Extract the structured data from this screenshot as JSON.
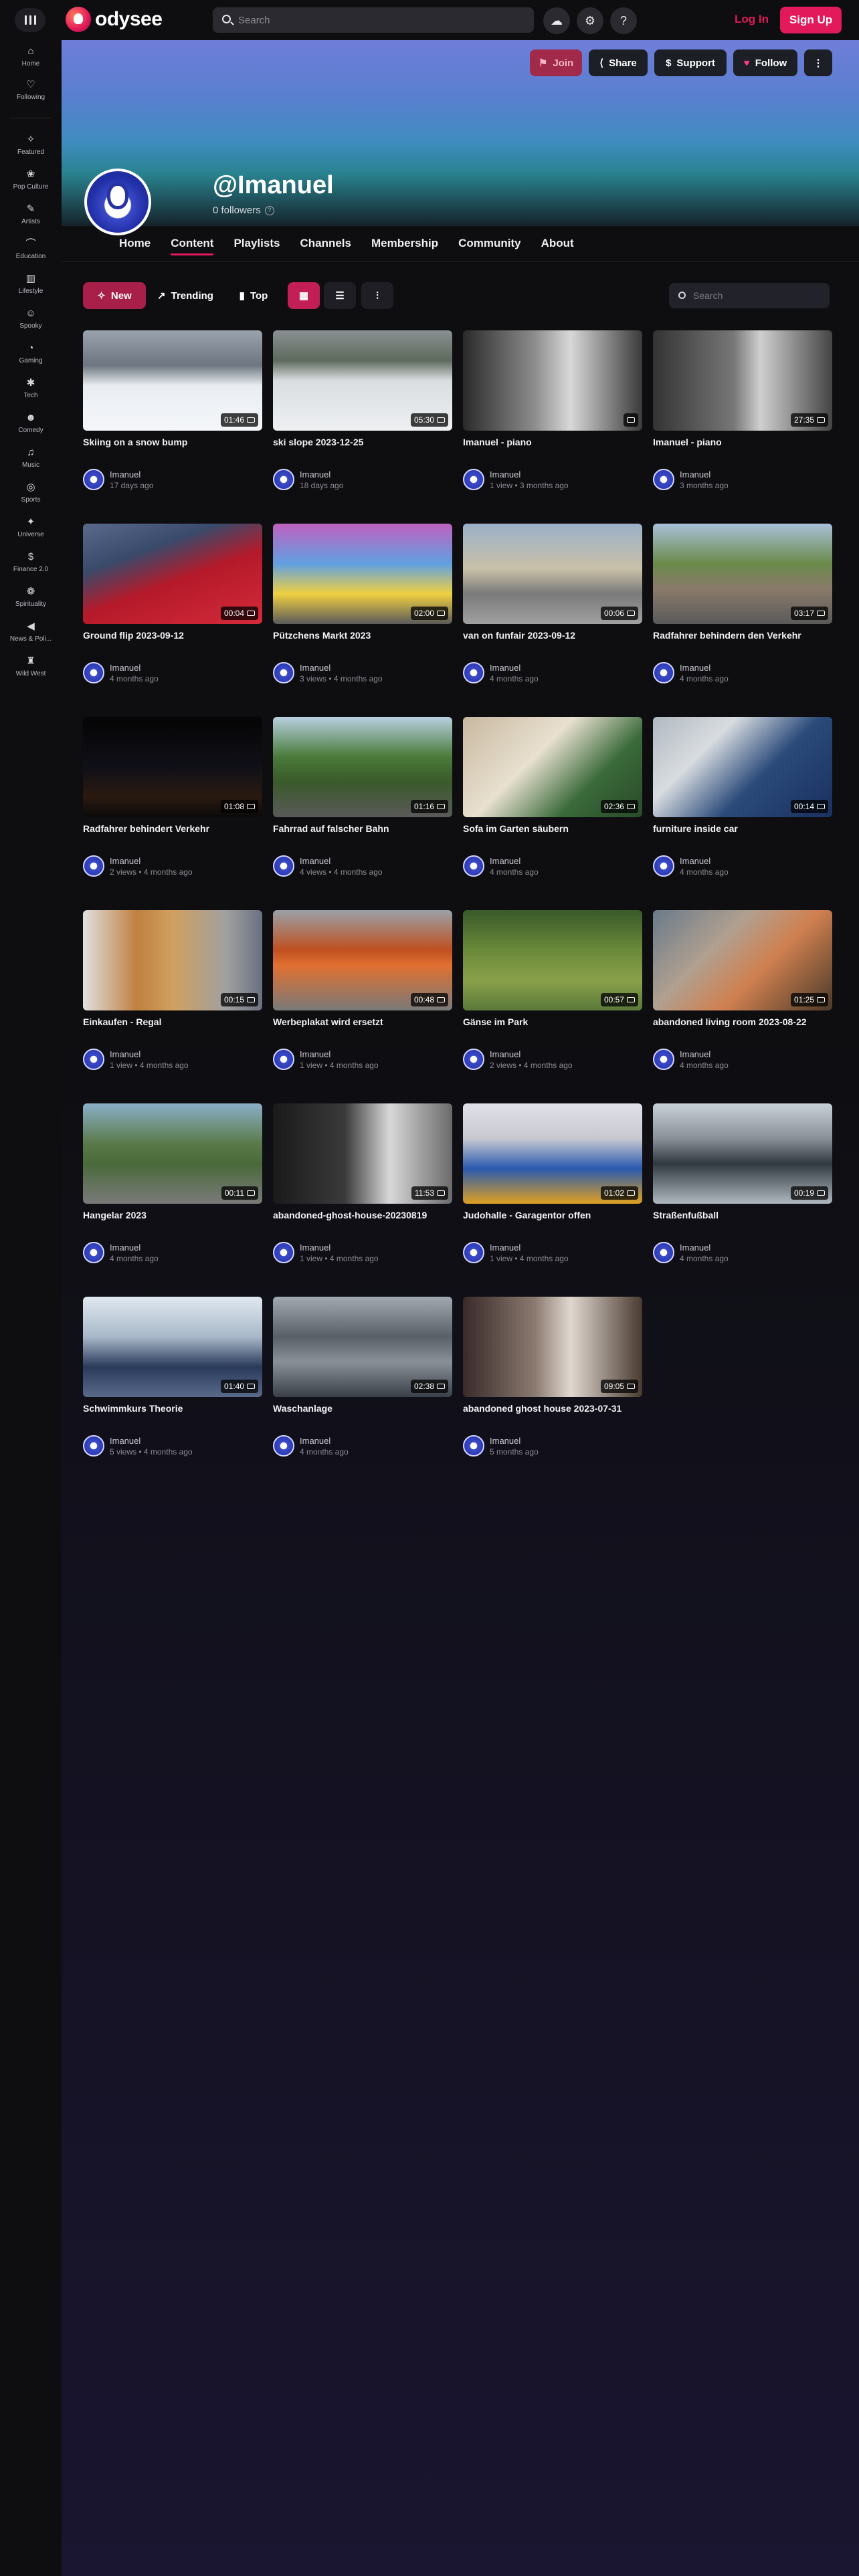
{
  "header": {
    "logo_text": "odysee",
    "search_placeholder": "Search",
    "login_label": "Log In",
    "signup_label": "Sign Up"
  },
  "sidebar": {
    "items": [
      {
        "label": "Home",
        "icon": "home-icon",
        "glyph": "⌂"
      },
      {
        "label": "Following",
        "icon": "heart-icon",
        "glyph": "♡"
      },
      {
        "label": "Featured",
        "icon": "sparkle-icon",
        "glyph": "✧"
      },
      {
        "label": "Pop Culture",
        "icon": "popcorn-icon",
        "glyph": "❀"
      },
      {
        "label": "Artists",
        "icon": "brush-icon",
        "glyph": "✎"
      },
      {
        "label": "Education",
        "icon": "graduation-icon",
        "glyph": "⌒"
      },
      {
        "label": "Lifestyle",
        "icon": "building-icon",
        "glyph": "▥"
      },
      {
        "label": "Spooky",
        "icon": "ghost-icon",
        "glyph": "☺"
      },
      {
        "label": "Gaming",
        "icon": "gamepad-icon",
        "glyph": "◔"
      },
      {
        "label": "Tech",
        "icon": "chip-icon",
        "glyph": "✱"
      },
      {
        "label": "Comedy",
        "icon": "mask-icon",
        "glyph": "☻"
      },
      {
        "label": "Music",
        "icon": "music-icon",
        "glyph": "♫"
      },
      {
        "label": "Sports",
        "icon": "ball-icon",
        "glyph": "◎"
      },
      {
        "label": "Universe",
        "icon": "planet-icon",
        "glyph": "✦"
      },
      {
        "label": "Finance 2.0",
        "icon": "dollar-icon",
        "glyph": "$"
      },
      {
        "label": "Spirituality",
        "icon": "lotus-icon",
        "glyph": "❁"
      },
      {
        "label": "News & Poli...",
        "icon": "megaphone-icon",
        "glyph": "◀"
      },
      {
        "label": "Wild West",
        "icon": "cowboy-icon",
        "glyph": "♜"
      }
    ]
  },
  "channel": {
    "name": "@Imanuel",
    "followers": "0 followers",
    "buttons": {
      "join": "Join",
      "share": "Share",
      "support": "Support",
      "follow": "Follow"
    },
    "tabs": [
      "Home",
      "Content",
      "Playlists",
      "Channels",
      "Membership",
      "Community",
      "About"
    ],
    "active_tab": "Content"
  },
  "filters": {
    "new": "New",
    "trending": "Trending",
    "top": "Top",
    "search_placeholder": "Search"
  },
  "colors": {
    "accent": "#e2195a",
    "background": "#0e0e11"
  },
  "videos": [
    {
      "title": "Skiing on a snow bump",
      "owner": "Imanuel",
      "meta": "17 days ago",
      "duration": "01:46"
    },
    {
      "title": "ski slope 2023-12-25",
      "owner": "Imanuel",
      "meta": "18 days ago",
      "duration": "05:30"
    },
    {
      "title": "Imanuel - piano",
      "owner": "Imanuel",
      "meta": "1 view • 3 months ago",
      "duration": ""
    },
    {
      "title": "Imanuel - piano",
      "owner": "Imanuel",
      "meta": "3 months ago",
      "duration": "27:35"
    },
    {
      "title": "Ground flip 2023-09-12",
      "owner": "Imanuel",
      "meta": "4 months ago",
      "duration": "00:04"
    },
    {
      "title": "Pützchens Markt 2023",
      "owner": "Imanuel",
      "meta": "3 views • 4 months ago",
      "duration": "02:00"
    },
    {
      "title": "van on funfair 2023-09-12",
      "owner": "Imanuel",
      "meta": "4 months ago",
      "duration": "00:06"
    },
    {
      "title": "Radfahrer behindern den Verkehr",
      "owner": "Imanuel",
      "meta": "4 months ago",
      "duration": "03:17"
    },
    {
      "title": "Radfahrer behindert Verkehr",
      "owner": "Imanuel",
      "meta": "2 views • 4 months ago",
      "duration": "01:08"
    },
    {
      "title": "Fahrrad auf falscher Bahn",
      "owner": "Imanuel",
      "meta": "4 views • 4 months ago",
      "duration": "01:16"
    },
    {
      "title": "Sofa im Garten säubern",
      "owner": "Imanuel",
      "meta": "4 months ago",
      "duration": "02:36"
    },
    {
      "title": "furniture inside car",
      "owner": "Imanuel",
      "meta": "4 months ago",
      "duration": "00:14"
    },
    {
      "title": "Einkaufen - Regal",
      "owner": "Imanuel",
      "meta": "1 view • 4 months ago",
      "duration": "00:15"
    },
    {
      "title": "Werbeplakat wird ersetzt",
      "owner": "Imanuel",
      "meta": "1 view • 4 months ago",
      "duration": "00:48"
    },
    {
      "title": "Gänse im Park",
      "owner": "Imanuel",
      "meta": "2 views • 4 months ago",
      "duration": "00:57"
    },
    {
      "title": "abandoned living room 2023-08-22",
      "owner": "Imanuel",
      "meta": "4 months ago",
      "duration": "01:25"
    },
    {
      "title": "Hangelar 2023",
      "owner": "Imanuel",
      "meta": "4 months ago",
      "duration": "00:11"
    },
    {
      "title": "abandoned-ghost-house-20230819",
      "owner": "Imanuel",
      "meta": "1 view • 4 months ago",
      "duration": "11:53"
    },
    {
      "title": "Judohalle - Garagentor offen",
      "owner": "Imanuel",
      "meta": "1 view • 4 months ago",
      "duration": "01:02"
    },
    {
      "title": "Straßenfußball",
      "owner": "Imanuel",
      "meta": "4 months ago",
      "duration": "00:19"
    },
    {
      "title": "Schwimmkurs Theorie",
      "owner": "Imanuel",
      "meta": "5 views • 4 months ago",
      "duration": "01:40"
    },
    {
      "title": "Waschanlage",
      "owner": "Imanuel",
      "meta": "4 months ago",
      "duration": "02:38"
    },
    {
      "title": "abandoned ghost house 2023-07-31",
      "owner": "Imanuel",
      "meta": "5 months ago",
      "duration": "09:05"
    }
  ]
}
